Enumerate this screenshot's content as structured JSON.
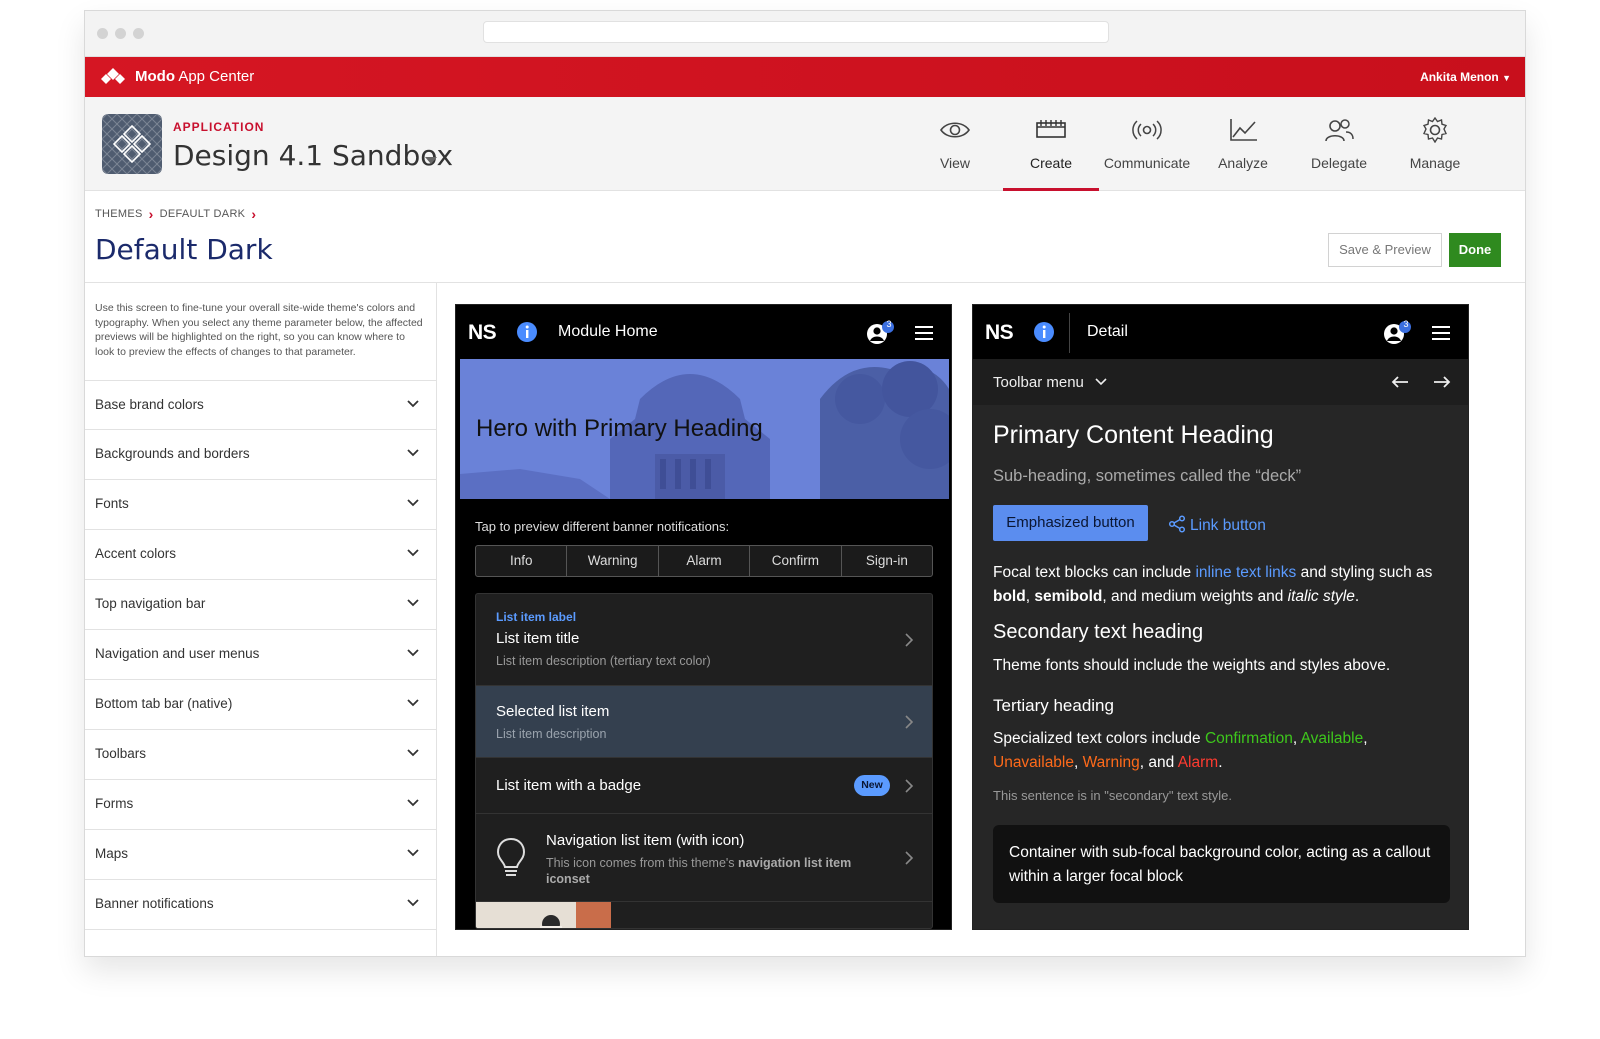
{
  "app": {
    "brand_name": "Modo",
    "brand_suffix": "App Center",
    "user": "Ankita Menon",
    "app_label": "APPLICATION",
    "app_name": "Design 4.1 Sandbox"
  },
  "nav": {
    "tabs": [
      {
        "label": "View",
        "icon": "eye-icon"
      },
      {
        "label": "Create",
        "icon": "create-icon",
        "active": true
      },
      {
        "label": "Communicate",
        "icon": "broadcast-icon"
      },
      {
        "label": "Analyze",
        "icon": "chart-icon"
      },
      {
        "label": "Delegate",
        "icon": "users-icon"
      },
      {
        "label": "Manage",
        "icon": "gear-icon"
      }
    ]
  },
  "breadcrumb": [
    "THEMES",
    "DEFAULT DARK"
  ],
  "page": {
    "title": "Default Dark",
    "save_preview": "Save & Preview",
    "done": "Done"
  },
  "sidebar": {
    "intro": "Use this screen to fine-tune your overall site-wide theme's colors and typography. When you select any theme parameter below, the affected previews will be highlighted on the right, so you can know where to look to preview the effects of changes to that parameter.",
    "sections": [
      "Base brand colors",
      "Backgrounds and borders",
      "Fonts",
      "Accent colors",
      "Top navigation bar",
      "Navigation and user menus",
      "Bottom tab bar (native)",
      "Toolbars",
      "Forms",
      "Maps",
      "Banner notifications"
    ]
  },
  "preview_home": {
    "logo": "NS",
    "title": "Module Home",
    "badge": "3",
    "hero": "Hero with Primary Heading",
    "tap_text": "Tap to preview different banner notifications:",
    "segments": [
      "Info",
      "Warning",
      "Alarm",
      "Confirm",
      "Sign-in"
    ],
    "list": {
      "label": "List item label",
      "title": "List item title",
      "desc": "List item description (tertiary text color)",
      "selected_title": "Selected list item",
      "selected_desc": "List item description",
      "badge_title": "List item with a badge",
      "badge": "New",
      "nav_title": "Navigation list item (with icon)",
      "nav_desc_prefix": "This icon comes from this theme's ",
      "nav_desc_bold": "navigation list item iconset"
    }
  },
  "preview_detail": {
    "logo": "NS",
    "title": "Detail",
    "badge": "3",
    "toolbar_menu": "Toolbar menu",
    "heading": "Primary Content Heading",
    "deck": "Sub-heading, sometimes called the “deck”",
    "emph_button": "Emphasized button",
    "link_button": "Link button",
    "focal_1": "Focal text blocks can include ",
    "focal_link": "inline text links",
    "focal_2": " and styling such as",
    "focal_bold": "bold",
    "focal_3": ", ",
    "focal_semibold": "semibold",
    "focal_4": ", and medium weights and ",
    "focal_italic": "italic style",
    "focal_5": ".",
    "secondary_heading": "Secondary text heading",
    "secondary_text": "Theme fonts should include the weights and styles above.",
    "tertiary_heading": "Tertiary heading",
    "special_prefix": "Specialized text colors include ",
    "confirmation": "Confirmation",
    "available": "Available",
    "unavailable": "Unavailable",
    "warning": "Warning",
    "and": ", and ",
    "alarm": "Alarm",
    "secondary_style": "This sentence is in \"secondary\" text style.",
    "callout": "Container with sub-focal background color, acting as a callout within a larger focal block"
  },
  "colors": {
    "brand_red": "#c8102e",
    "done_green": "#2f8a1f",
    "link_blue": "#4a90ff",
    "confirmation": "#3ec71c",
    "available": "#3ec71c",
    "unavailable": "#ff6a1a",
    "warning": "#ff6a1a",
    "alarm": "#ff3b30"
  }
}
